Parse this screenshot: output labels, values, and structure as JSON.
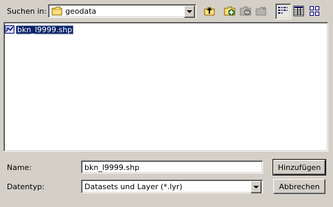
{
  "lookin": {
    "label": "Suchen in:",
    "folder": "geodata"
  },
  "toolbar": {
    "up_icon": "folder-up-icon",
    "connect_icon": "connect-folder-icon",
    "disconnect_icon": "disconnect-folder-icon",
    "new_folder_icon": "new-folder-icon",
    "list_view_icon": "list-view-icon",
    "details_view_icon": "details-view-icon",
    "thumbnail_view_icon": "thumbnail-view-icon"
  },
  "files": [
    {
      "name": "bkn_l9999.shp",
      "icon": "shapefile-icon",
      "selected": true
    }
  ],
  "name_field": {
    "label": "Name:",
    "value": "bkn_l9999.shp"
  },
  "type_field": {
    "label": "Datentyp:",
    "value": "Datasets und Layer (*.lyr)"
  },
  "buttons": {
    "add": "Hinzufügen",
    "cancel": "Abbrechen"
  },
  "colors": {
    "face": "#d4d0c8",
    "selection": "#0a246a"
  }
}
